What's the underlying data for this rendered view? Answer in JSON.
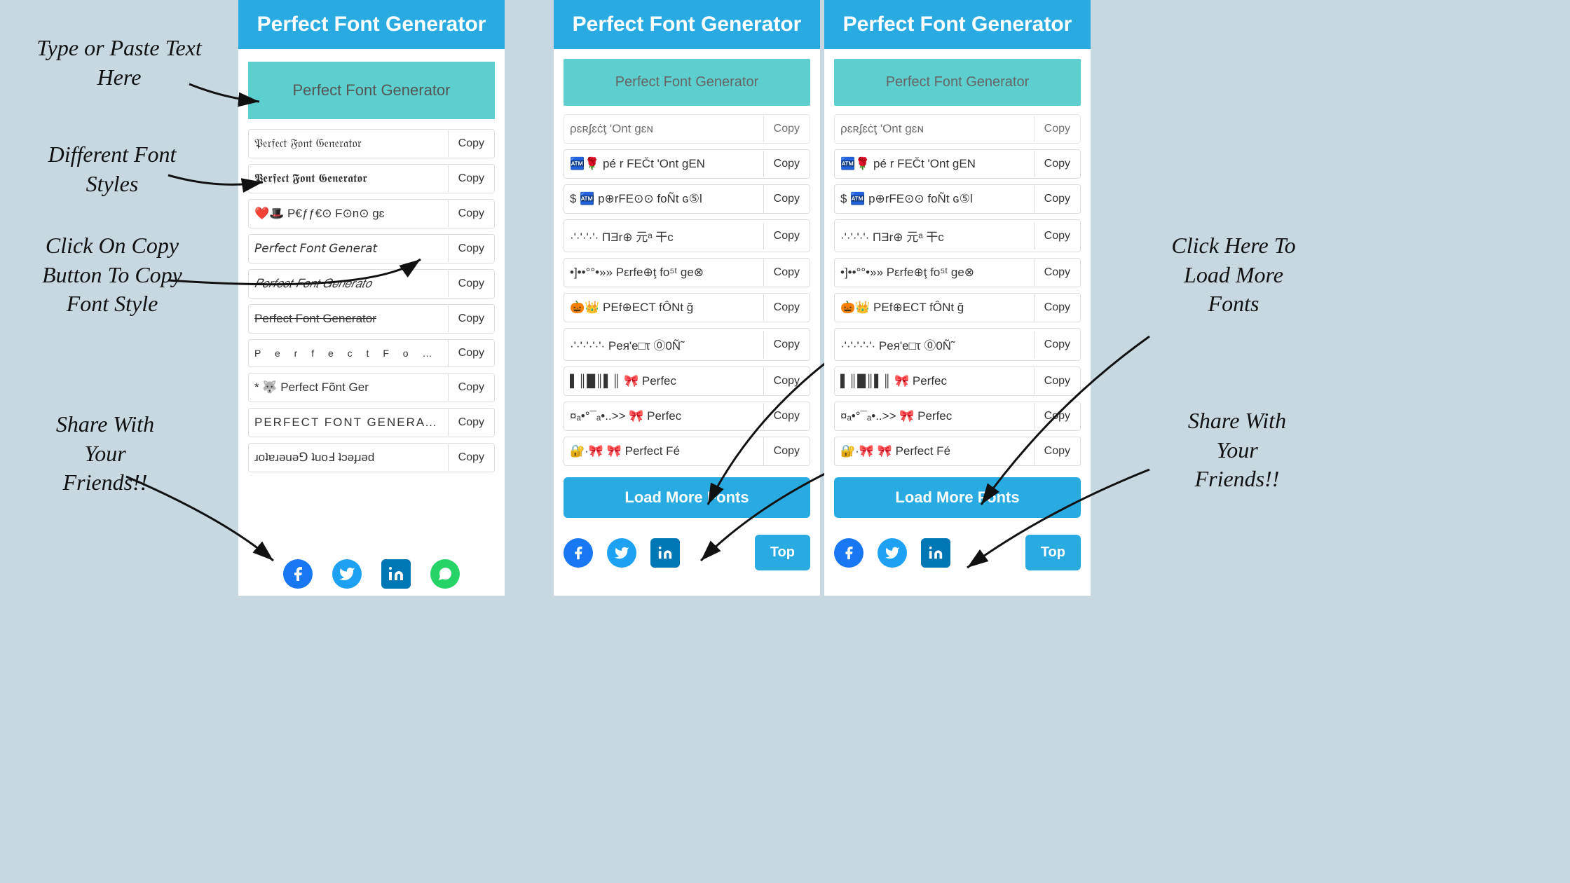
{
  "annotations": {
    "type_paste": "Type or Paste Text\nHere",
    "different_fonts": "Different Font\nStyles",
    "click_copy": "Click On Copy\nButton To Copy\nFont Style",
    "share_left": "Share With\nYour\nFriends!!",
    "click_load": "Click Here To\nLoad More\nFonts",
    "share_right": "Share With\nYour\nFriends!!"
  },
  "panel_header": "Perfect Font Generator",
  "input_placeholder": "Perfect Font Generator",
  "font_rows_left": [
    {
      "text": "𝔓𝔢𝔯𝔣𝔢𝔠𝔱 𝔉𝔬𝔫𝔱 𝔊𝔢𝔫𝔢𝔯𝔞𝔱𝔬𝔯",
      "copy": "Copy",
      "style": "fraktur"
    },
    {
      "text": "𝕻𝖊𝖗𝖋𝖊𝖈𝖙 𝕱𝖔𝖓𝖙 𝕲𝖊𝖓𝖊𝖗𝖆𝖙𝖔𝖗",
      "copy": "Copy",
      "style": "bold-fraktur"
    },
    {
      "text": "❤️🎩 P€ƒƒ€⊙ F⊙n⊙ gɛ",
      "copy": "Copy",
      "style": "emoji"
    },
    {
      "text": "𝘗𝘦𝘳𝘧𝘦𝘤𝘵 𝘍𝘰𝘯𝘵 𝘎𝘦𝘯𝘦𝘳𝘢𝘵",
      "copy": "Copy",
      "style": "italic-sans"
    },
    {
      "text": "𝑃𝑒𝑟𝑓𝑒𝑐𝑡 𝐹𝑜𝑛𝑡 𝐺𝑒𝑛𝑒𝑟𝑎𝑡𝑜",
      "copy": "Copy",
      "style": "math-italic"
    },
    {
      "text": "Perfect Fоnt Generator",
      "copy": "Copy",
      "style": "strikethrough"
    },
    {
      "text": "P  e  r  f  e  c  t    F  o  n  t",
      "copy": "Copy",
      "style": "spaced"
    },
    {
      "text": "* 🐺 Perfect Fõnt Ger",
      "copy": "Copy",
      "style": "emoji2"
    },
    {
      "text": "PERFECT FONT GENERATOR",
      "copy": "Copy",
      "style": "upper"
    },
    {
      "text": "ɹoʇɐɹǝuǝ⅁ ʇuoℲ ʇɔǝɟɹǝd",
      "copy": "Copy",
      "style": "flip"
    }
  ],
  "font_rows_right": [
    {
      "text": "ρɛʀʄɛċţ 'Ont gɛɴ",
      "copy": "Copy",
      "partial": true
    },
    {
      "text": "🏧🌹 pé r FEČt 'Ont gEN",
      "copy": "Copy"
    },
    {
      "text": "$ 🏧 p⊕rFE⊙⊙ foÑt ɢ⑤l",
      "copy": "Copy"
    },
    {
      "text": "·'·'·'·'· ΠƎr⊕ 元ᵃ 干c",
      "copy": "Copy"
    },
    {
      "text": "•]••°°•»» Pεrfe⊕ţ fo⁵ᵗ ge⊗",
      "copy": "Copy"
    },
    {
      "text": "🎃👑 ΡEf⊕ECT fÔNt ğ",
      "copy": "Copy"
    },
    {
      "text": "·'·'·'·'·'· Pея'e□τ ⓪0Ñ˜",
      "copy": "Copy"
    },
    {
      "text": "▌║█║▌║ 🎀 Perfec",
      "copy": "Copy"
    },
    {
      "text": "¤ₐ•°¯ₐ•..>> 🎀 Perfec",
      "copy": "Copy"
    },
    {
      "text": "🔐·🎀 🎀 Perfect Fé",
      "copy": "Copy"
    }
  ],
  "load_more_btn": "Load More Fonts",
  "top_btn": "Top",
  "social": {
    "facebook": "f",
    "twitter": "t",
    "linkedin": "in",
    "whatsapp": "w"
  }
}
